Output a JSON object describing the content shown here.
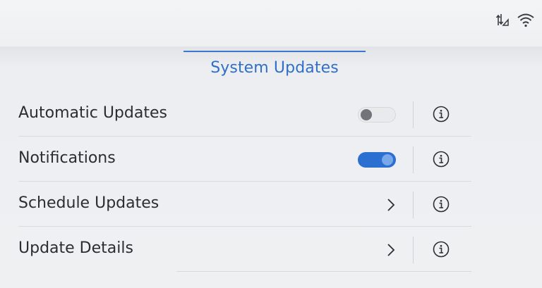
{
  "status_bar": {
    "icons": [
      "data-transfer-icon",
      "wifi-icon"
    ]
  },
  "header": {
    "title": "System Updates"
  },
  "settings": {
    "rows": [
      {
        "label": "Automatic Updates",
        "control": "toggle",
        "enabled": false,
        "info_icon": "info-icon"
      },
      {
        "label": "Notifications",
        "control": "toggle",
        "enabled": true,
        "info_icon": "info-icon"
      },
      {
        "label": "Schedule Updates",
        "control": "chevron",
        "info_icon": "info-icon"
      },
      {
        "label": "Update Details",
        "control": "chevron",
        "info_icon": "info-icon"
      }
    ]
  },
  "colors": {
    "accent": "#2f6fc8",
    "toggle_on": "#2b6fd1",
    "toggle_off": "#e9eaec",
    "text": "#2b2d33",
    "background": "#eef0f2"
  }
}
